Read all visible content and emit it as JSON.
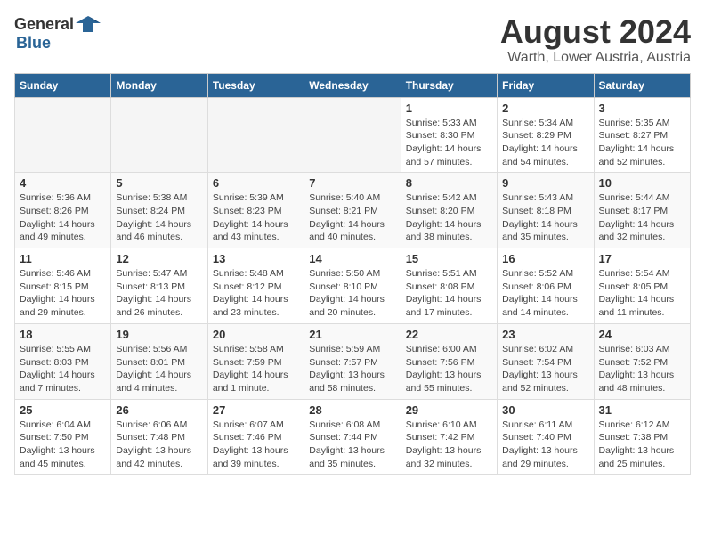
{
  "header": {
    "logo_general": "General",
    "logo_blue": "Blue",
    "title": "August 2024",
    "subtitle": "Warth, Lower Austria, Austria"
  },
  "days_of_week": [
    "Sunday",
    "Monday",
    "Tuesday",
    "Wednesday",
    "Thursday",
    "Friday",
    "Saturday"
  ],
  "weeks": [
    [
      {
        "day": "",
        "detail": ""
      },
      {
        "day": "",
        "detail": ""
      },
      {
        "day": "",
        "detail": ""
      },
      {
        "day": "",
        "detail": ""
      },
      {
        "day": "1",
        "detail": "Sunrise: 5:33 AM\nSunset: 8:30 PM\nDaylight: 14 hours\nand 57 minutes."
      },
      {
        "day": "2",
        "detail": "Sunrise: 5:34 AM\nSunset: 8:29 PM\nDaylight: 14 hours\nand 54 minutes."
      },
      {
        "day": "3",
        "detail": "Sunrise: 5:35 AM\nSunset: 8:27 PM\nDaylight: 14 hours\nand 52 minutes."
      }
    ],
    [
      {
        "day": "4",
        "detail": "Sunrise: 5:36 AM\nSunset: 8:26 PM\nDaylight: 14 hours\nand 49 minutes."
      },
      {
        "day": "5",
        "detail": "Sunrise: 5:38 AM\nSunset: 8:24 PM\nDaylight: 14 hours\nand 46 minutes."
      },
      {
        "day": "6",
        "detail": "Sunrise: 5:39 AM\nSunset: 8:23 PM\nDaylight: 14 hours\nand 43 minutes."
      },
      {
        "day": "7",
        "detail": "Sunrise: 5:40 AM\nSunset: 8:21 PM\nDaylight: 14 hours\nand 40 minutes."
      },
      {
        "day": "8",
        "detail": "Sunrise: 5:42 AM\nSunset: 8:20 PM\nDaylight: 14 hours\nand 38 minutes."
      },
      {
        "day": "9",
        "detail": "Sunrise: 5:43 AM\nSunset: 8:18 PM\nDaylight: 14 hours\nand 35 minutes."
      },
      {
        "day": "10",
        "detail": "Sunrise: 5:44 AM\nSunset: 8:17 PM\nDaylight: 14 hours\nand 32 minutes."
      }
    ],
    [
      {
        "day": "11",
        "detail": "Sunrise: 5:46 AM\nSunset: 8:15 PM\nDaylight: 14 hours\nand 29 minutes."
      },
      {
        "day": "12",
        "detail": "Sunrise: 5:47 AM\nSunset: 8:13 PM\nDaylight: 14 hours\nand 26 minutes."
      },
      {
        "day": "13",
        "detail": "Sunrise: 5:48 AM\nSunset: 8:12 PM\nDaylight: 14 hours\nand 23 minutes."
      },
      {
        "day": "14",
        "detail": "Sunrise: 5:50 AM\nSunset: 8:10 PM\nDaylight: 14 hours\nand 20 minutes."
      },
      {
        "day": "15",
        "detail": "Sunrise: 5:51 AM\nSunset: 8:08 PM\nDaylight: 14 hours\nand 17 minutes."
      },
      {
        "day": "16",
        "detail": "Sunrise: 5:52 AM\nSunset: 8:06 PM\nDaylight: 14 hours\nand 14 minutes."
      },
      {
        "day": "17",
        "detail": "Sunrise: 5:54 AM\nSunset: 8:05 PM\nDaylight: 14 hours\nand 11 minutes."
      }
    ],
    [
      {
        "day": "18",
        "detail": "Sunrise: 5:55 AM\nSunset: 8:03 PM\nDaylight: 14 hours\nand 7 minutes."
      },
      {
        "day": "19",
        "detail": "Sunrise: 5:56 AM\nSunset: 8:01 PM\nDaylight: 14 hours\nand 4 minutes."
      },
      {
        "day": "20",
        "detail": "Sunrise: 5:58 AM\nSunset: 7:59 PM\nDaylight: 14 hours\nand 1 minute."
      },
      {
        "day": "21",
        "detail": "Sunrise: 5:59 AM\nSunset: 7:57 PM\nDaylight: 13 hours\nand 58 minutes."
      },
      {
        "day": "22",
        "detail": "Sunrise: 6:00 AM\nSunset: 7:56 PM\nDaylight: 13 hours\nand 55 minutes."
      },
      {
        "day": "23",
        "detail": "Sunrise: 6:02 AM\nSunset: 7:54 PM\nDaylight: 13 hours\nand 52 minutes."
      },
      {
        "day": "24",
        "detail": "Sunrise: 6:03 AM\nSunset: 7:52 PM\nDaylight: 13 hours\nand 48 minutes."
      }
    ],
    [
      {
        "day": "25",
        "detail": "Sunrise: 6:04 AM\nSunset: 7:50 PM\nDaylight: 13 hours\nand 45 minutes."
      },
      {
        "day": "26",
        "detail": "Sunrise: 6:06 AM\nSunset: 7:48 PM\nDaylight: 13 hours\nand 42 minutes."
      },
      {
        "day": "27",
        "detail": "Sunrise: 6:07 AM\nSunset: 7:46 PM\nDaylight: 13 hours\nand 39 minutes."
      },
      {
        "day": "28",
        "detail": "Sunrise: 6:08 AM\nSunset: 7:44 PM\nDaylight: 13 hours\nand 35 minutes."
      },
      {
        "day": "29",
        "detail": "Sunrise: 6:10 AM\nSunset: 7:42 PM\nDaylight: 13 hours\nand 32 minutes."
      },
      {
        "day": "30",
        "detail": "Sunrise: 6:11 AM\nSunset: 7:40 PM\nDaylight: 13 hours\nand 29 minutes."
      },
      {
        "day": "31",
        "detail": "Sunrise: 6:12 AM\nSunset: 7:38 PM\nDaylight: 13 hours\nand 25 minutes."
      }
    ]
  ]
}
